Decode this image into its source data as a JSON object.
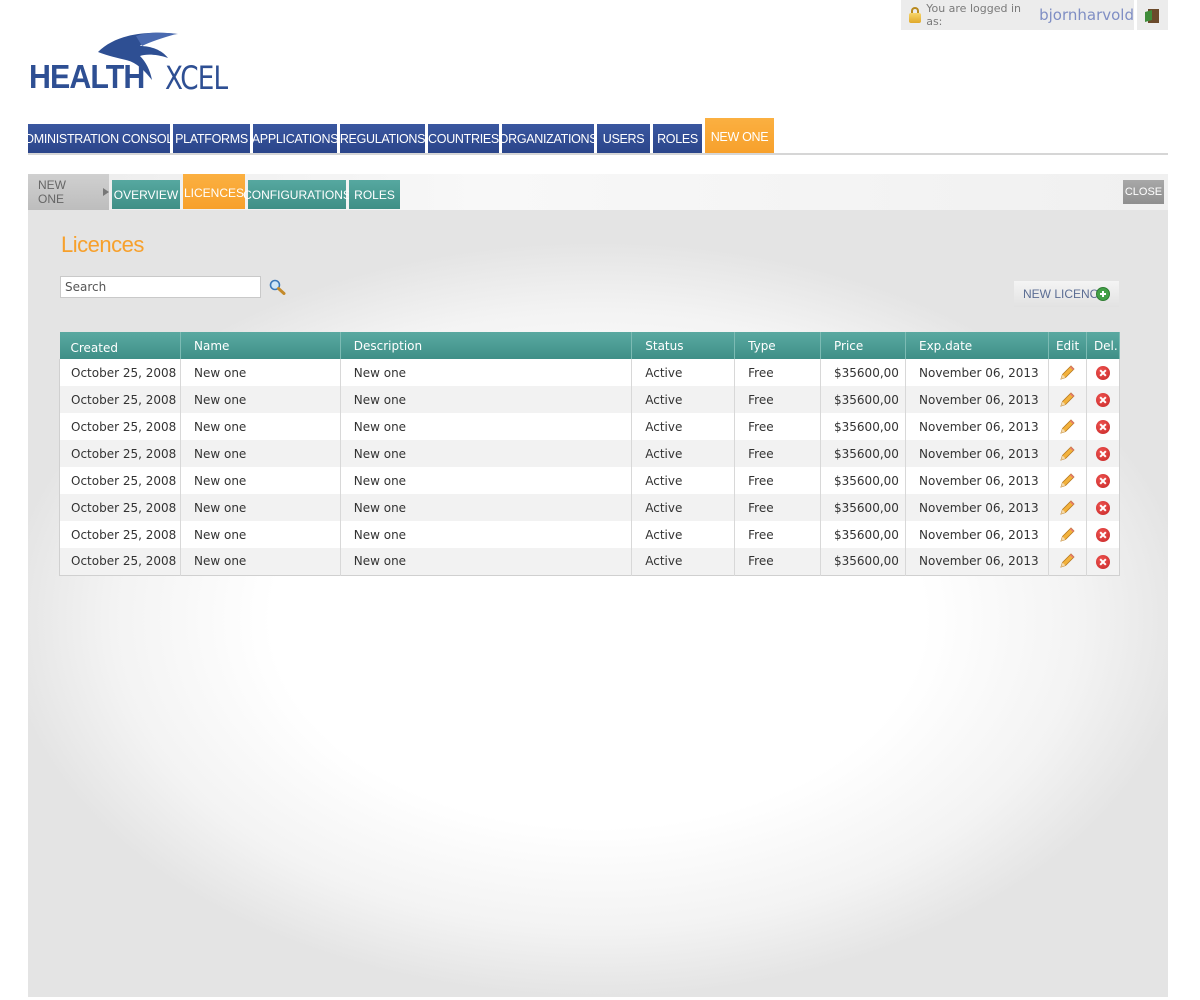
{
  "session": {
    "logged_in_label": "You are logged in as:",
    "username": "bjornharvold"
  },
  "logo": {
    "part1": "HEALTH",
    "part2": "XCEL",
    "primary_color": "#2e4f93"
  },
  "main_nav": {
    "items": [
      {
        "label": "ADMINISTRATION CONSOLE"
      },
      {
        "label": "PLATFORMS"
      },
      {
        "label": "APPLICATIONS"
      },
      {
        "label": "REGULATIONS"
      },
      {
        "label": "COUNTRIES"
      },
      {
        "label": "ORGANIZATIONS"
      },
      {
        "label": "USERS"
      },
      {
        "label": "ROLES"
      },
      {
        "label": "NEW ONE"
      }
    ],
    "active_index": 8
  },
  "sub_nav": {
    "breadcrumb": "NEW ONE",
    "tabs": [
      {
        "label": "OVERVIEW"
      },
      {
        "label": "LICENCES"
      },
      {
        "label": "CONFIGURATIONS"
      },
      {
        "label": "ROLES"
      }
    ],
    "active_index": 1,
    "close_label": "CLOSE"
  },
  "page": {
    "title": "Licences",
    "search_placeholder": "Search",
    "new_button_label": "NEW LICENCE"
  },
  "table": {
    "columns": [
      "Created",
      "Name",
      "Description",
      "Status",
      "Type",
      "Price",
      "Exp.date",
      "Edit",
      "Del."
    ],
    "rows": [
      [
        "October 25, 2008",
        "New one",
        "New one",
        "Active",
        "Free",
        "$35600,00",
        "November 06, 2013"
      ],
      [
        "October 25, 2008",
        "New one",
        "New one",
        "Active",
        "Free",
        "$35600,00",
        "November 06, 2013"
      ],
      [
        "October 25, 2008",
        "New one",
        "New one",
        "Active",
        "Free",
        "$35600,00",
        "November 06, 2013"
      ],
      [
        "October 25, 2008",
        "New one",
        "New one",
        "Active",
        "Free",
        "$35600,00",
        "November 06, 2013"
      ],
      [
        "October 25, 2008",
        "New one",
        "New one",
        "Active",
        "Free",
        "$35600,00",
        "November 06, 2013"
      ],
      [
        "October 25, 2008",
        "New one",
        "New one",
        "Active",
        "Free",
        "$35600,00",
        "November 06, 2013"
      ],
      [
        "October 25, 2008",
        "New one",
        "New one",
        "Active",
        "Free",
        "$35600,00",
        "November 06, 2013"
      ],
      [
        "October 25, 2008",
        "New one",
        "New one",
        "Active",
        "Free",
        "$35600,00",
        "November 06, 2013"
      ]
    ]
  },
  "icons": {
    "lock": "lock-icon",
    "logout": "logout-door-icon",
    "search": "magnifier-icon",
    "add": "plus-circle-icon",
    "edit": "pencil-icon",
    "delete": "delete-x-icon"
  },
  "colors": {
    "nav_blue": "#2e4f93",
    "accent_orange": "#f7a02b",
    "teal": "#4a9b93"
  }
}
